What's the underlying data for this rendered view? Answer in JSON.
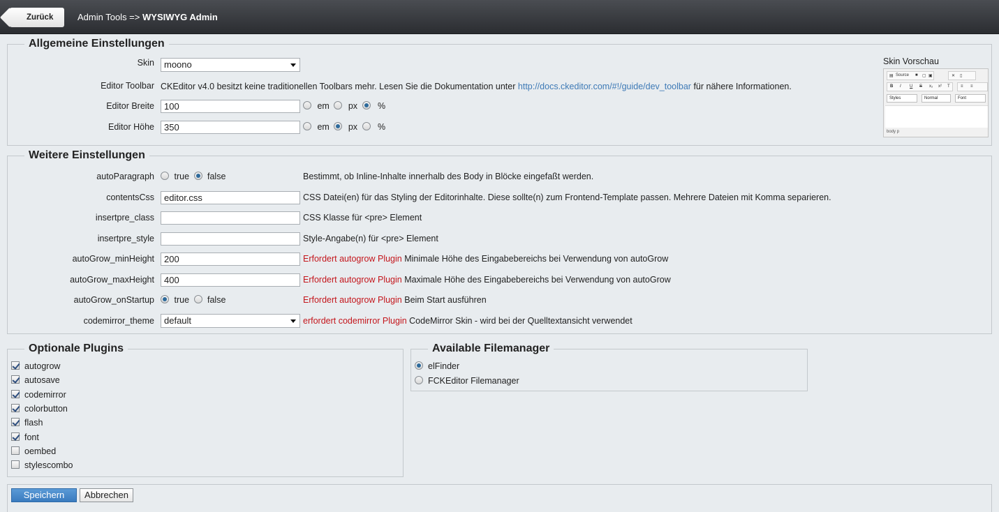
{
  "header": {
    "back_label": "Zurück",
    "breadcrumb_prefix": "Admin Tools =>",
    "breadcrumb_current": "WYSIWYG Admin"
  },
  "general": {
    "legend": "Allgemeine Einstellungen",
    "skin_label": "Skin",
    "skin_value": "moono",
    "toolbar_label": "Editor Toolbar",
    "toolbar_text_before": "CKEditor v4.0 besitzt keine traditionellen Toolbars mehr. Lesen Sie die Dokumentation unter",
    "toolbar_link": "http://docs.ckeditor.com/#!/guide/dev_toolbar",
    "toolbar_text_after": "für nähere Informationen.",
    "width_label": "Editor Breite",
    "width_value": "100",
    "width_unit": "%",
    "height_label": "Editor Höhe",
    "height_value": "350",
    "height_unit": "px",
    "unit_em": "em",
    "unit_px": "px",
    "unit_pct": "%",
    "preview_title": "Skin Vorschau",
    "preview": {
      "source": "Source",
      "styles": "Styles",
      "format": "Normal",
      "font": "Font",
      "status": "body  p"
    }
  },
  "more": {
    "legend": "Weitere Einstellungen",
    "true_label": "true",
    "false_label": "false",
    "rows": {
      "autoParagraph": {
        "label": "autoParagraph",
        "value": "false",
        "desc": "Bestimmt, ob Inline-Inhalte innerhalb des Body in Blöcke eingefaßt werden."
      },
      "contentsCss": {
        "label": "contentsCss",
        "value": "editor.css",
        "desc": "CSS Datei(en) für das Styling der Editorinhalte. Diese sollte(n) zum Frontend-Template passen. Mehrere Dateien mit Komma separieren."
      },
      "insertpre_class": {
        "label": "insertpre_class",
        "value": "",
        "desc": "CSS Klasse für <pre> Element"
      },
      "insertpre_style": {
        "label": "insertpre_style",
        "value": "",
        "desc": "Style-Angabe(n) für <pre> Element"
      },
      "autoGrow_minHeight": {
        "label": "autoGrow_minHeight",
        "value": "200",
        "req": "Erfordert autogrow Plugin",
        "desc": "Minimale Höhe des Eingabebereichs bei Verwendung von autoGrow"
      },
      "autoGrow_maxHeight": {
        "label": "autoGrow_maxHeight",
        "value": "400",
        "req": "Erfordert autogrow Plugin",
        "desc": "Maximale Höhe des Eingabebereichs bei Verwendung von autoGrow"
      },
      "autoGrow_onStartup": {
        "label": "autoGrow_onStartup",
        "value": "true",
        "req": "Erfordert autogrow Plugin",
        "desc": "Beim Start ausführen"
      },
      "codemirror_theme": {
        "label": "codemirror_theme",
        "value": "default",
        "req": "erfordert codemirror Plugin",
        "desc": "CodeMirror Skin - wird bei der Quelltextansicht verwendet"
      }
    }
  },
  "plugins": {
    "legend": "Optionale Plugins",
    "items": [
      {
        "label": "autogrow",
        "checked": true
      },
      {
        "label": "autosave",
        "checked": true
      },
      {
        "label": "codemirror",
        "checked": true
      },
      {
        "label": "colorbutton",
        "checked": true
      },
      {
        "label": "flash",
        "checked": true
      },
      {
        "label": "font",
        "checked": true
      },
      {
        "label": "oembed",
        "checked": false
      },
      {
        "label": "stylescombo",
        "checked": false
      }
    ]
  },
  "filemanager": {
    "legend": "Available Filemanager",
    "items": [
      {
        "label": "elFinder",
        "selected": true
      },
      {
        "label": "FCKEditor Filemanager",
        "selected": false
      }
    ]
  },
  "actions": {
    "save_label": "Speichern",
    "cancel_label": "Abbrechen"
  },
  "colors": {
    "accent": "#3a7bbf",
    "required": "#c4161c",
    "link": "#3e7ab6"
  }
}
